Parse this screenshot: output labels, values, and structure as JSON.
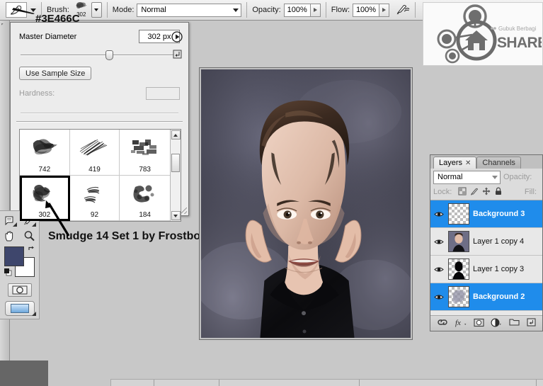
{
  "options_bar": {
    "tool_icon": "paintbrush-icon",
    "brush_label": "Brush:",
    "brush_size": "302",
    "mode_label": "Mode:",
    "mode_value": "Normal",
    "opacity_label": "Opacity:",
    "opacity_value": "100%",
    "flow_label": "Flow:",
    "flow_value": "100%",
    "airbrush_icon": "airbrush-icon"
  },
  "brush_panel": {
    "master_diameter_label": "Master Diameter",
    "master_diameter_value": "302 px",
    "use_sample_size_label": "Use Sample Size",
    "hardness_label": "Hardness:",
    "hardness_value": "",
    "menu_icon": "panel-menu-icon",
    "preset_icon": "preset-manager-icon",
    "presets": [
      {
        "size": "742",
        "selected": false
      },
      {
        "size": "419",
        "selected": false
      },
      {
        "size": "783",
        "selected": false
      },
      {
        "size": "302",
        "selected": true
      },
      {
        "size": "92",
        "selected": false
      },
      {
        "size": "184",
        "selected": false
      }
    ]
  },
  "annotation": {
    "brush_note": "Smudge 14 Set 1 by Frostbo",
    "color_hex": "#3E466C"
  },
  "toolbar": {
    "tools": [
      {
        "name": "notes-tool",
        "has_submenu": true
      },
      {
        "name": "eyedropper-tool",
        "has_submenu": true
      },
      {
        "name": "hand-tool",
        "has_submenu": false
      },
      {
        "name": "zoom-tool",
        "has_submenu": false
      }
    ],
    "foreground_color": "#3E466C",
    "background_color": "#FFFFFF",
    "swap_icon": "swap-colors-icon",
    "default_colors_icon": "default-colors-icon",
    "quick_mask_icon": "quick-mask-icon",
    "screen_mode_icon": "screen-mode-icon"
  },
  "logo": {
    "brand": "SHAREHOVEL",
    "tagline": "Gubuk Berbagi",
    "icon": "house-network-icon"
  },
  "layers_panel": {
    "tabs": [
      {
        "label": "Layers",
        "active": true,
        "closable": true
      },
      {
        "label": "Channels",
        "active": false,
        "closable": false
      }
    ],
    "blend_mode": "Normal",
    "opacity_label": "Opacity:",
    "lock_label": "Lock:",
    "fill_label": "Fill:",
    "lock_icons": [
      "lock-transparent-icon",
      "lock-image-icon",
      "lock-position-icon",
      "lock-all-icon"
    ],
    "layers": [
      {
        "name": "Background 3",
        "selected": true,
        "visible": true,
        "thumb": "transparent"
      },
      {
        "name": "Layer 1 copy 4",
        "selected": false,
        "visible": true,
        "thumb": "portrait"
      },
      {
        "name": "Layer 1 copy 3",
        "selected": false,
        "visible": true,
        "thumb": "silhouette"
      },
      {
        "name": "Background 2",
        "selected": true,
        "visible": true,
        "thumb": "smoke"
      }
    ],
    "footer_icons": [
      "link-layers-icon",
      "layer-style-fx-icon",
      "layer-mask-icon",
      "adjustment-layer-icon",
      "new-group-icon",
      "new-layer-icon"
    ]
  },
  "document": {
    "title": "caricature-portrait",
    "subject": "man-caricature-with-large-ears-black-shirt"
  }
}
